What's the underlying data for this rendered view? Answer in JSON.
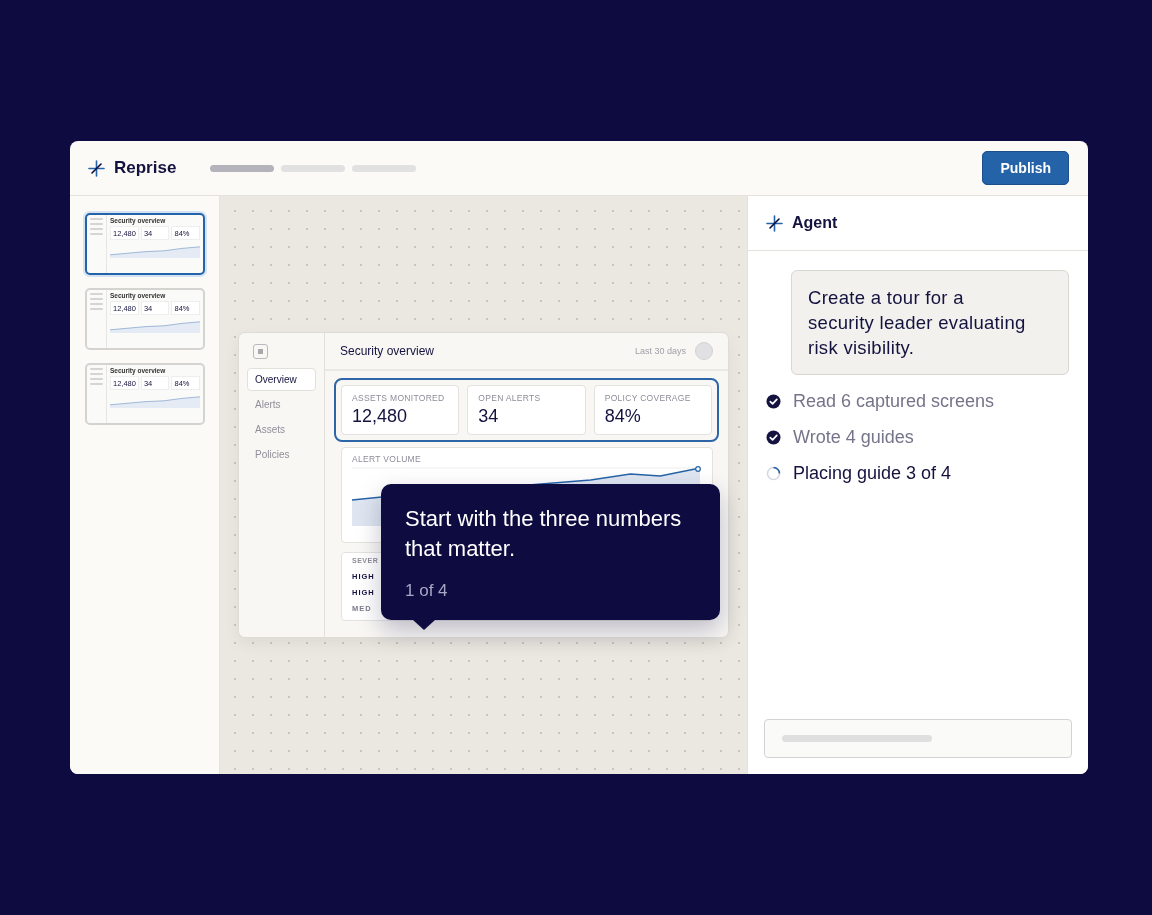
{
  "app": {
    "name": "Reprise",
    "progress_steps": [
      {
        "done": true
      },
      {
        "done": false
      },
      {
        "done": false
      }
    ],
    "publish_button": "Publish"
  },
  "thumbnails": [
    {
      "selected": true,
      "title": "Security overview",
      "values": [
        "12,480",
        "34",
        "84%"
      ]
    },
    {
      "selected": false,
      "title": "Security overview",
      "values": [
        "12,480",
        "34",
        "84%"
      ]
    },
    {
      "selected": false,
      "title": "Security overview",
      "values": [
        "12,480",
        "34",
        "84%"
      ]
    }
  ],
  "preview": {
    "nav": [
      {
        "label": "Overview",
        "selected": true
      },
      {
        "label": "Alerts",
        "selected": false
      },
      {
        "label": "Assets",
        "selected": false
      },
      {
        "label": "Policies",
        "selected": false
      }
    ],
    "title": "Security overview",
    "range": "Last 30 days",
    "metrics_highlighted": true,
    "metrics": [
      {
        "label": "ASSETS MONITORED",
        "value": "12,480"
      },
      {
        "label": "OPEN ALERTS",
        "value": "34"
      },
      {
        "label": "POLICY COVERAGE",
        "value": "84%"
      }
    ],
    "chart_title": "ALERT VOLUME",
    "table": {
      "header": "SEVER",
      "rows": [
        {
          "kind": "high",
          "text": "HIGH"
        },
        {
          "kind": "high",
          "text": "HIGH"
        },
        {
          "kind": "med",
          "text": "MED"
        }
      ]
    }
  },
  "tooltip": {
    "text": "Start with the three numbers that matter.",
    "step": "1 of 4"
  },
  "agent": {
    "title": "Agent",
    "prompt": "Create a tour for a security leader evaluating risk visibility.",
    "steps": [
      {
        "kind": "done",
        "text": "Read 6 captured screens"
      },
      {
        "kind": "done",
        "text": "Wrote 4 guides"
      },
      {
        "kind": "running",
        "text": "Placing guide 3 of 4"
      }
    ]
  }
}
